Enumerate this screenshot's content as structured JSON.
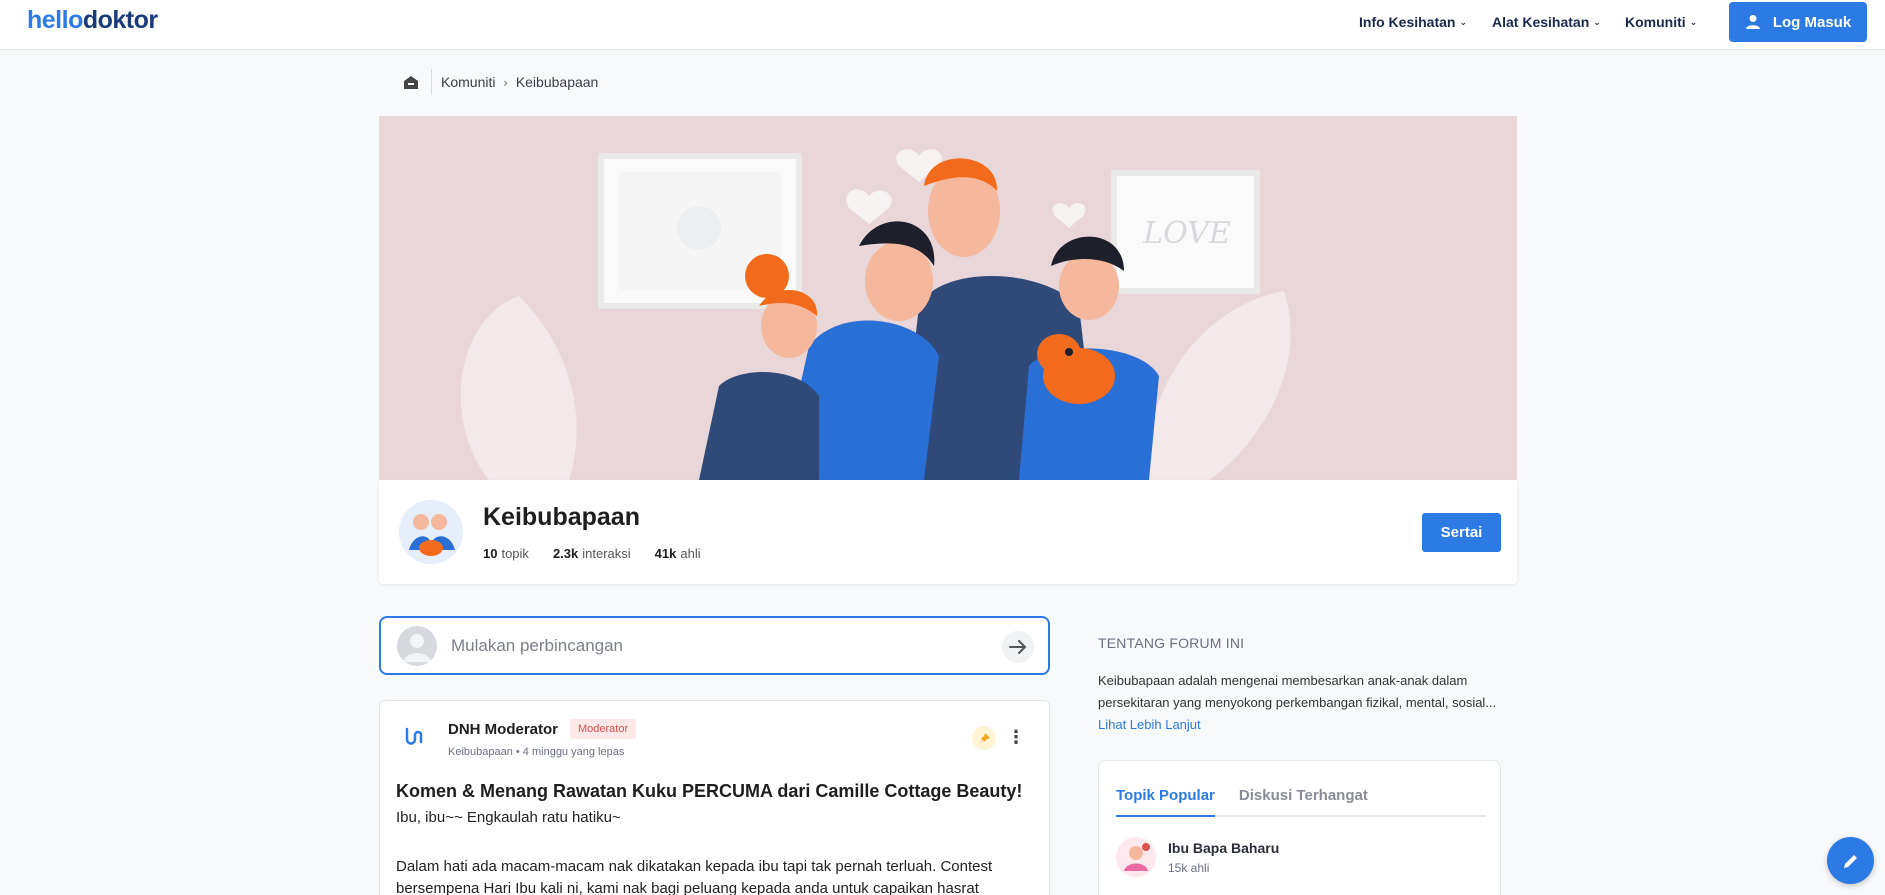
{
  "header": {
    "logo": {
      "part1": "hello",
      "part2": "doktor"
    },
    "nav": [
      {
        "label": "Info Kesihatan"
      },
      {
        "label": "Alat Kesihatan"
      },
      {
        "label": "Komuniti"
      }
    ],
    "login_label": "Log Masuk"
  },
  "breadcrumb": {
    "items": [
      "Komuniti",
      "Keibubapaan"
    ]
  },
  "hero": {
    "frame_text": "LOVE"
  },
  "forum": {
    "title": "Keibubapaan",
    "stats": [
      {
        "value": "10",
        "label": "topik"
      },
      {
        "value": "2.3k",
        "label": "interaksi"
      },
      {
        "value": "41k",
        "label": "ahli"
      }
    ],
    "join_label": "Sertai"
  },
  "composer": {
    "placeholder": "Mulakan perbincangan"
  },
  "post": {
    "author": "DNH Moderator",
    "badge": "Moderator",
    "meta": "Keibubapaan • 4 minggu yang lepas",
    "title": "Komen & Menang Rawatan Kuku PERCUMA dari Camille Cottage Beauty!",
    "subtitle": "Ibu, ibu~~ Engkaulah ratu hatiku~",
    "body": "Dalam hati ada macam-macam nak dikatakan kepada ibu tapi tak pernah terluah. Contest bersempena Hari Ibu kali ni, kami nak bagi peluang kepada anda untuk capaikan hasrat"
  },
  "sidebar": {
    "about_heading": "TENTANG FORUM INI",
    "about_text": "Keibubapaan adalah mengenai membesarkan anak-anak dalam persekitaran yang menyokong perkembangan fizikal, mental, sosial...",
    "about_link": "Lihat Lebih Lanjut",
    "tabs": [
      {
        "label": "Topik Popular"
      },
      {
        "label": "Diskusi Terhangat"
      }
    ],
    "topics": [
      {
        "name": "Ibu Bapa Baharu",
        "count": "15k ahli"
      }
    ]
  },
  "colors": {
    "primary": "#2c7be5",
    "hero_bg": "#e8d6d8",
    "badge_bg": "#fde8e8",
    "badge_text": "#d9534f"
  }
}
